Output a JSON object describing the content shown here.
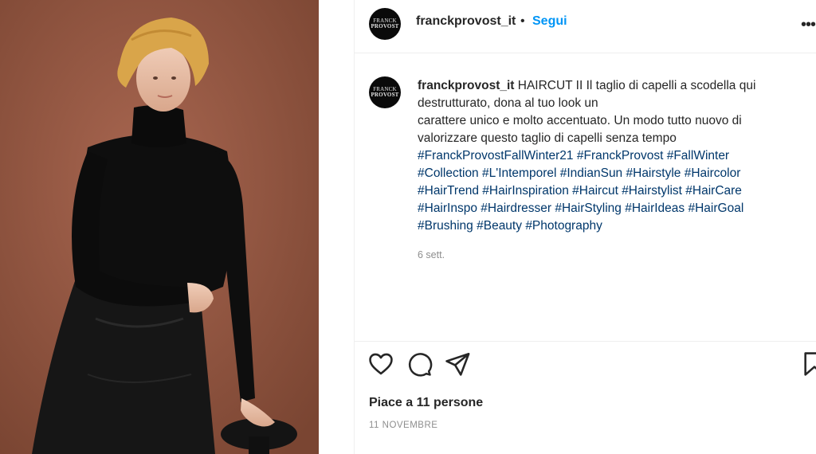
{
  "colors": {
    "background_photo": "#9a5a44",
    "follow": "#0095f6",
    "hashtag": "#00376b",
    "muted": "#8e8e8e"
  },
  "header": {
    "avatar_logo_line1": "FRANCK",
    "avatar_logo_line2": "PROVOST",
    "username": "franckprovost_it",
    "separator": "•",
    "follow_label": "Segui",
    "more_icon": "more-horizontal-icon"
  },
  "caption": {
    "username": "franckprovost_it",
    "text_lines": [
      " HAIRCUT II Il taglio di capelli a scodella qui destrutturato, dona al tuo look un",
      "carattere unico e molto accentuato. Un modo tutto nuovo di valorizzare questo taglio di capelli senza tempo"
    ],
    "hashtags": [
      "#FranckProvostFallWinter21",
      "#FranckProvost",
      "#FallWinter",
      "#Collection",
      "#L'Intemporel",
      "#IndianSun",
      "#Hairstyle",
      "#Haircolor",
      "#HairTrend",
      "#HairInspiration",
      "#Haircut",
      "#Hairstylist",
      "#HairCare",
      "#HairInspo",
      "#Hairdresser",
      "#HairStyling",
      "#HairIdeas",
      "#HairGoal",
      "#Brushing",
      "#Beauty",
      "#Photography"
    ],
    "time": "6 sett."
  },
  "actions": {
    "icons": [
      "heart-icon",
      "comment-icon",
      "share-icon",
      "bookmark-icon"
    ]
  },
  "likes": "Piace a 11 persone",
  "date": "11 NOVEMBRE"
}
